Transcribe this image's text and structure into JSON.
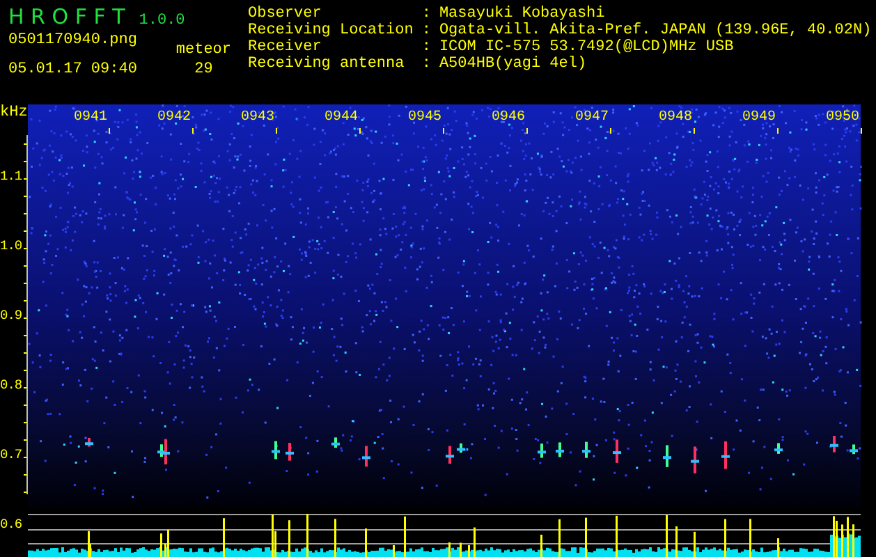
{
  "app": {
    "title": "H R O F F T",
    "version": "1.0.0",
    "filename": "0501170940.png",
    "datetime": "05.01.17 09:40",
    "meteor_label": "meteor",
    "meteor_count": "29"
  },
  "info": [
    {
      "label": "Observer",
      "separator": ":",
      "value": "Masayuki Kobayashi"
    },
    {
      "label": "Receiving Location",
      "separator": ":",
      "value": "Ogata-vill. Akita-Pref. JAPAN (139.96E, 40.02N)"
    },
    {
      "label": "Receiver",
      "separator": ":",
      "value": "ICOM IC-575 53.7492(@LCD)MHz USB"
    },
    {
      "label": "Receiving antenna",
      "separator": ":",
      "value": "A504HB(yagi 4el)"
    }
  ],
  "spectrogram": {
    "freq_unit": "kHz",
    "freq_labels": [
      "1.1",
      "1.0",
      "0.9",
      "0.8",
      "0.7",
      "0.6"
    ],
    "time_labels": [
      "0941",
      "0942",
      "0943",
      "0944",
      "0945",
      "0946",
      "0947",
      "0948",
      "0949",
      "0950"
    ]
  }
}
